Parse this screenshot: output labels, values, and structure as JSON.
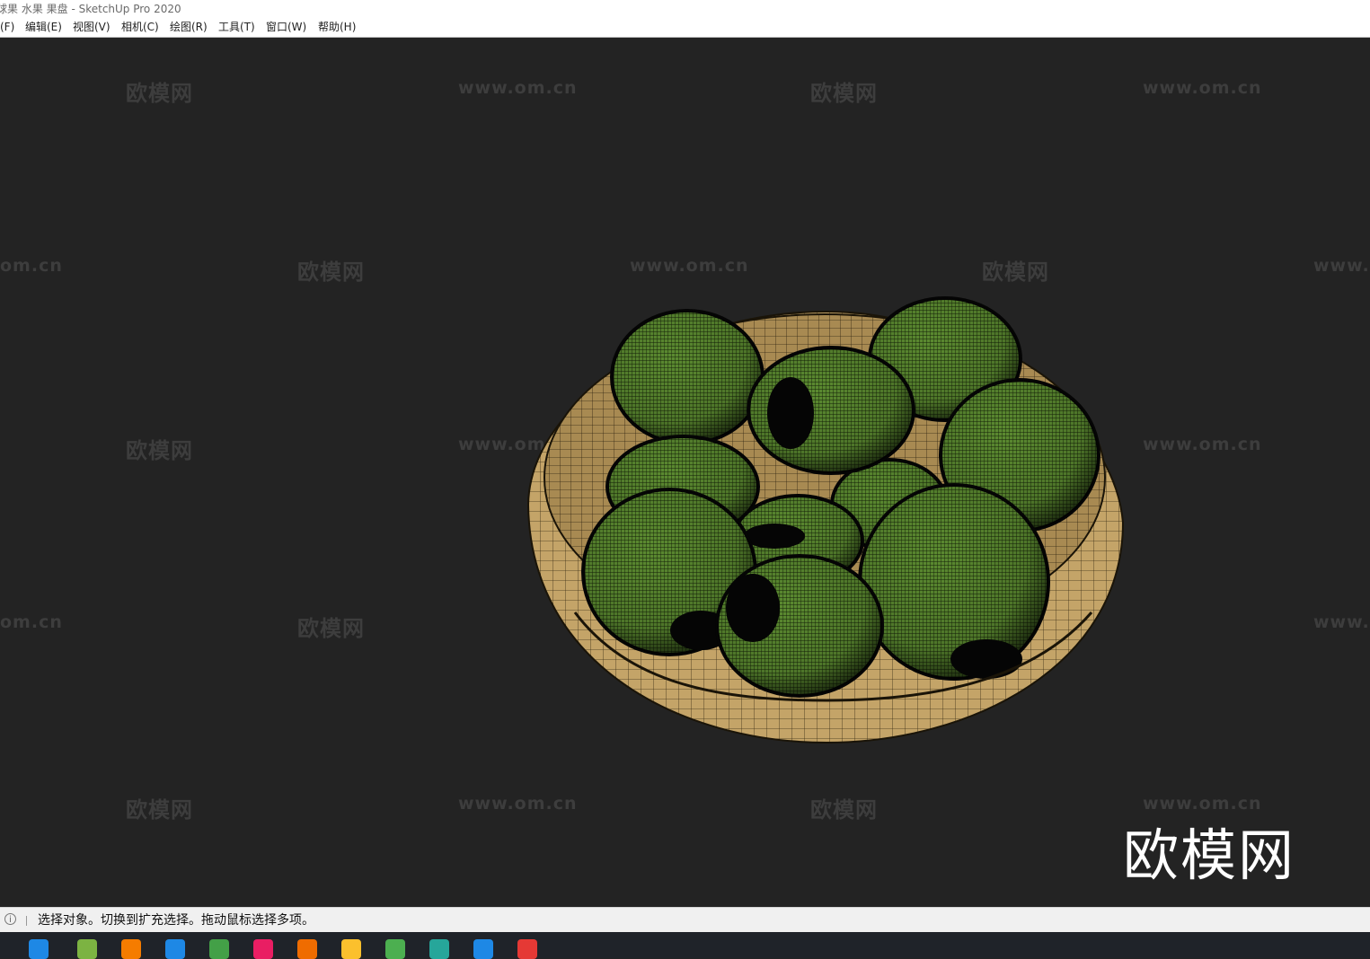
{
  "window": {
    "title": "球果 水果 果盘 - SketchUp Pro 2020"
  },
  "menu": [
    {
      "label": "(F)"
    },
    {
      "label": "编辑(E)"
    },
    {
      "label": "视图(V)"
    },
    {
      "label": "相机(C)"
    },
    {
      "label": "绘图(R)"
    },
    {
      "label": "工具(T)"
    },
    {
      "label": "窗口(W)"
    },
    {
      "label": "帮助(H)"
    }
  ],
  "watermarks": {
    "logo_text": "欧模网",
    "url_text": "www.om.cn",
    "url_partial_left": "om.cn",
    "url_partial_right": "www."
  },
  "status": {
    "text": "选择对象。切换到扩充选择。拖动鼠标选择多项。",
    "info_icon": "i"
  },
  "taskbar": {
    "icons": [
      {
        "name": "ie-icon",
        "color": "#1e88e5"
      },
      {
        "name": "app-game-icon",
        "color": "#7cb342"
      },
      {
        "name": "media-player-icon",
        "color": "#f57c00"
      },
      {
        "name": "shield-app-icon",
        "color": "#1e88e5"
      },
      {
        "name": "play-store-icon",
        "color": "#43a047"
      },
      {
        "name": "color-wheel-icon",
        "color": "#e91e63"
      },
      {
        "name": "pdf-app-icon",
        "color": "#ef6c00"
      },
      {
        "name": "file-explorer-icon",
        "color": "#fbc02d"
      },
      {
        "name": "wechat-icon",
        "color": "#4caf50"
      },
      {
        "name": "3dsmax-icon",
        "color": "#26a69a"
      },
      {
        "name": "edge-icon",
        "color": "#1e88e5"
      },
      {
        "name": "sketchup-icon",
        "color": "#e53935"
      }
    ]
  },
  "colors": {
    "viewport_bg": "#232323",
    "bowl": "#c8a86a",
    "apple": "#5a8a32",
    "wire": "#0d0d0d"
  }
}
